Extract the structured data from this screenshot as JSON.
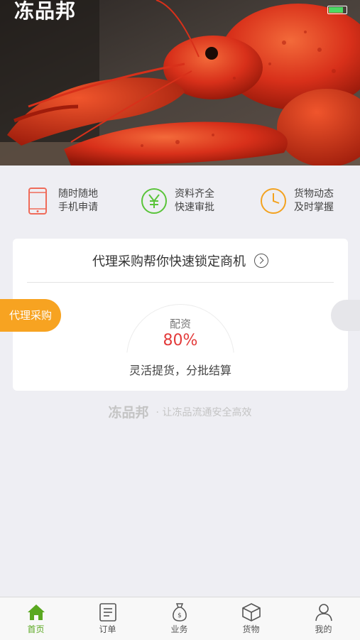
{
  "header": {
    "brand": "冻品邦"
  },
  "features": [
    {
      "icon": "phone-icon",
      "line1": "随时随地",
      "line2": "手机申请",
      "color": "#ef6b5a"
    },
    {
      "icon": "yuan-icon",
      "line1": "资料齐全",
      "line2": "快速审批",
      "color": "#5ac43a"
    },
    {
      "icon": "clock-icon",
      "line1": "货物动态",
      "line2": "及时掌握",
      "color": "#f3a21f"
    }
  ],
  "card": {
    "title": "代理采购帮你快速锁定商机",
    "loan_label": "配资",
    "loan_rate": "80%",
    "loan_desc": "灵活提货，分批结算"
  },
  "side_tab": {
    "label": "代理采购",
    "color": "#f7a321"
  },
  "footer": {
    "brand": "冻品邦",
    "slogan": "· 让冻品流通安全高效"
  },
  "tabbar": {
    "active_color": "#5aa820",
    "items": [
      {
        "label": "首页",
        "icon": "home-icon",
        "active": true
      },
      {
        "label": "订单",
        "icon": "order-icon",
        "active": false
      },
      {
        "label": "业务",
        "icon": "money-bag-icon",
        "active": false
      },
      {
        "label": "货物",
        "icon": "box-icon",
        "active": false
      },
      {
        "label": "我的",
        "icon": "user-icon",
        "active": false
      }
    ]
  }
}
